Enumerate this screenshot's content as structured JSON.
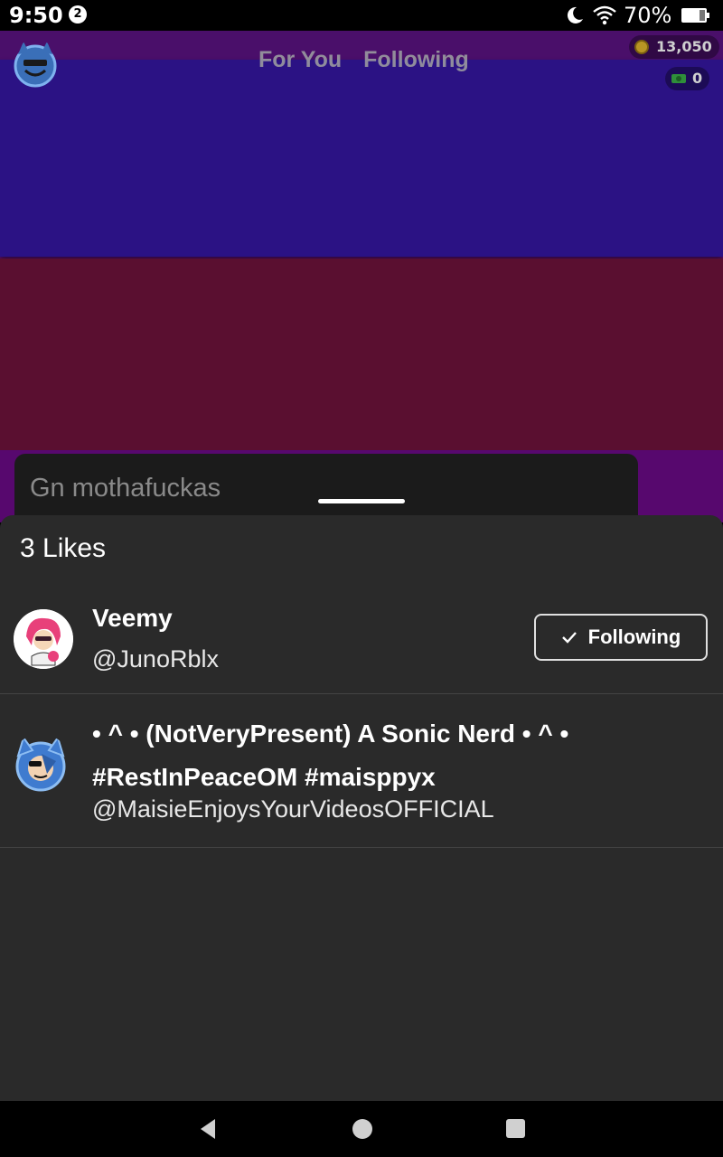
{
  "status_bar": {
    "time": "9:50",
    "notification_count": "2",
    "battery": "70%"
  },
  "top_bar": {
    "tabs": [
      {
        "label": "For You"
      },
      {
        "label": "Following"
      }
    ],
    "coins": "13,050",
    "props": "0"
  },
  "post": {
    "caption": "Gn mothafuckas"
  },
  "likes_sheet": {
    "title": "3 Likes",
    "users": [
      {
        "name": "Veemy",
        "handle": "@JunoRblx",
        "follow_label": "Following"
      },
      {
        "name": "• ^ • (NotVeryPresent) A Sonic Nerd • ^ • #RestInPeaceOM #maisppyx",
        "handle": "@MaisieEnjoysYourVideosOFFICIAL"
      }
    ]
  },
  "colors": {
    "sheet_bg": "#2a2a2a",
    "band_blue": "#2b1284",
    "band_red": "#5a0f30",
    "band_purple": "#57086e"
  }
}
